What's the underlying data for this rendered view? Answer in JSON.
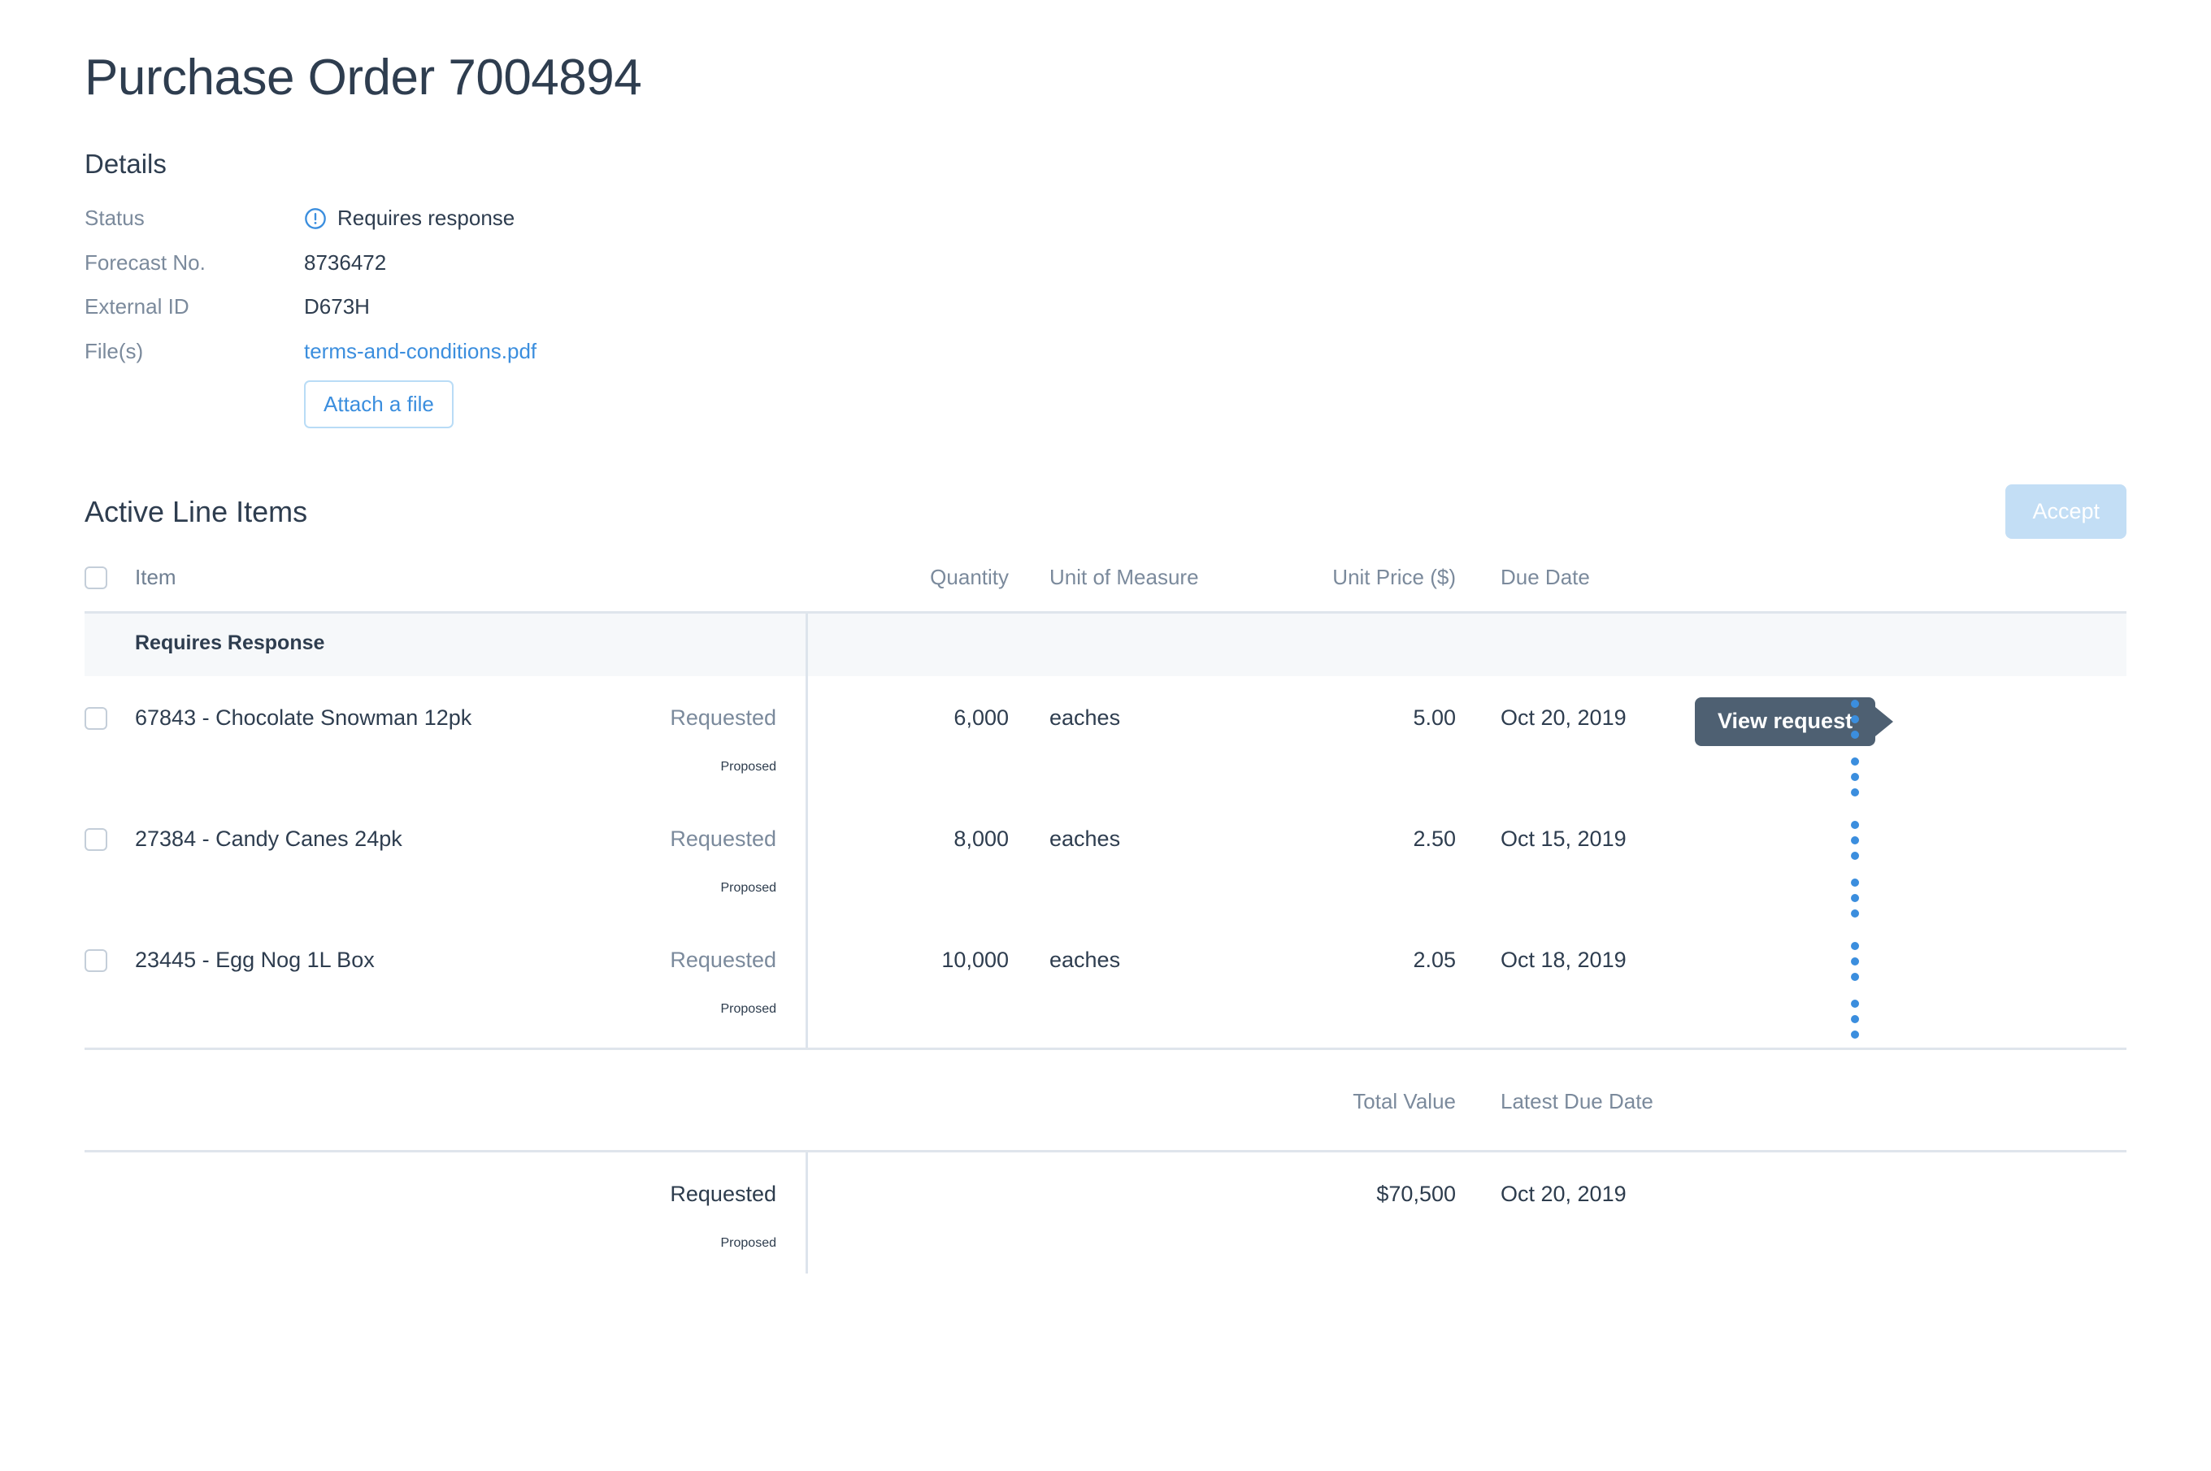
{
  "page": {
    "title": "Purchase Order 7004894"
  },
  "details": {
    "heading": "Details",
    "rows": [
      {
        "label": "Status",
        "value": "Requires response",
        "icon": "alert-circle-icon"
      },
      {
        "label": "Forecast No.",
        "value": "8736472"
      },
      {
        "label": "External ID",
        "value": "D673H"
      },
      {
        "label": "File(s)",
        "value": "terms-and-conditions.pdf"
      }
    ],
    "attach_button": "Attach a file"
  },
  "line_items": {
    "heading": "Active Line Items",
    "accept_button": "Accept",
    "columns": {
      "item": "Item",
      "quantity": "Quantity",
      "unit_of_measure": "Unit of Measure",
      "unit_price": "Unit Price ($)",
      "due_date": "Due Date"
    },
    "group_label": "Requires Response",
    "state_labels": {
      "requested": "Requested",
      "proposed": "Proposed"
    },
    "tooltip": "View request",
    "rows": [
      {
        "item": "67843 - Chocolate Snowman 12pk",
        "requested": {
          "quantity": "6,000",
          "unit_of_measure": "eaches",
          "unit_price": "5.00",
          "due_date": "Oct 20, 2019"
        },
        "proposed": {
          "quantity": "",
          "unit_of_measure": "",
          "unit_price": "",
          "due_date": ""
        }
      },
      {
        "item": "27384 - Candy Canes 24pk",
        "requested": {
          "quantity": "8,000",
          "unit_of_measure": "eaches",
          "unit_price": "2.50",
          "due_date": "Oct 15, 2019"
        },
        "proposed": {
          "quantity": "",
          "unit_of_measure": "",
          "unit_price": "",
          "due_date": ""
        }
      },
      {
        "item": "23445 - Egg Nog 1L Box",
        "requested": {
          "quantity": "10,000",
          "unit_of_measure": "eaches",
          "unit_price": "2.05",
          "due_date": "Oct 18, 2019"
        },
        "proposed": {
          "quantity": "",
          "unit_of_measure": "",
          "unit_price": "",
          "due_date": ""
        }
      }
    ],
    "totals": {
      "total_value_label": "Total Value",
      "latest_due_date_label": "Latest Due Date",
      "requested": {
        "total_value": "$70,500",
        "latest_due_date": "Oct 20, 2019"
      },
      "proposed": {
        "total_value": "",
        "latest_due_date": ""
      }
    }
  },
  "colors": {
    "accent_blue": "#3b8ede",
    "text_dark": "#2e3d4f",
    "text_muted": "#7b8a9c",
    "border": "#dfe5ec",
    "band_bg": "#f6f8fa",
    "accept_disabled": "#c3def5",
    "tooltip_bg": "#4e6072"
  }
}
